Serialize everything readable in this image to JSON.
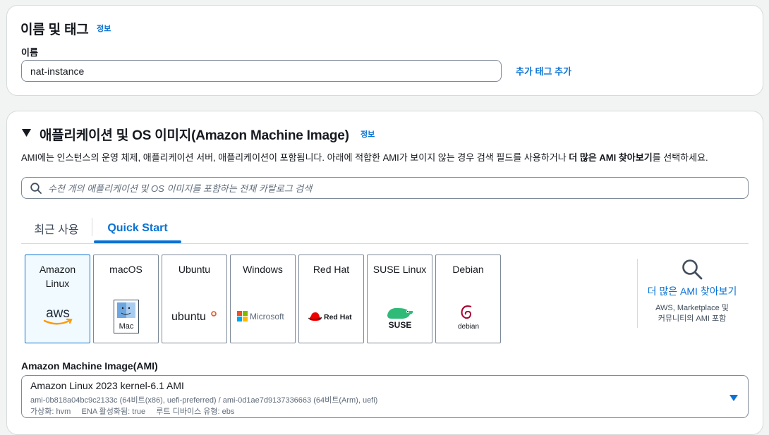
{
  "name_tags": {
    "title": "이름 및 태그",
    "info": "정보",
    "name_label": "이름",
    "name_value": "nat-instance",
    "add_tags": "추가 태그 추가"
  },
  "ami": {
    "title": "애플리케이션 및 OS 이미지(Amazon Machine Image)",
    "info": "정보",
    "description_pre": "AMI에는 인스턴스의 운영 체제, 애플리케이션 서버, 애플리케이션이 포함됩니다. 아래에 적합한 AMI가 보이지 않는 경우 검색 필드를 사용하거나 ",
    "description_bold": "더 많은 AMI 찾아보기",
    "description_post": "를 선택하세요.",
    "search_placeholder": "수천 개의 애플리케이션 및 OS 이미지를 포함하는 전체 카탈로그 검색",
    "tabs": [
      {
        "label": "최근 사용",
        "active": false
      },
      {
        "label": "Quick Start",
        "active": true
      }
    ],
    "os_options": [
      {
        "name": "Amazon Linux",
        "logo": "aws-logo",
        "selected": true
      },
      {
        "name": "macOS",
        "logo": "mac-logo",
        "logo_text": "Mac",
        "selected": false
      },
      {
        "name": "Ubuntu",
        "logo": "ubuntu-logo",
        "logo_text": "ubuntu",
        "selected": false
      },
      {
        "name": "Windows",
        "logo": "microsoft-logo",
        "logo_text": "Microsoft",
        "selected": false
      },
      {
        "name": "Red Hat",
        "logo": "redhat-logo",
        "logo_text": "Red Hat",
        "selected": false
      },
      {
        "name": "SUSE Linux",
        "logo": "suse-logo",
        "logo_text": "SUSE",
        "selected": false
      },
      {
        "name": "Debian",
        "logo": "debian-logo",
        "logo_text": "debian",
        "selected": false
      }
    ],
    "browse_more": {
      "link": "더 많은 AMI 찾아보기",
      "sub_line1": "AWS, Marketplace 및",
      "sub_line2": "커뮤니티의 AMI 포함"
    },
    "ami_label": "Amazon Machine Image(AMI)",
    "selected_ami": {
      "name": "Amazon Linux 2023 kernel-6.1 AMI",
      "ids": "ami-0b818a04bc9c2133c (64비트(x86), uefi-preferred) / ami-0d1ae7d9137336663 (64비트(Arm), uefi)",
      "details": "가상화: hvm     ENA 활성화됨: true     루트 디바이스 유형: ebs"
    }
  },
  "colors": {
    "link": "#0972d3",
    "border": "#7d8998",
    "selected_bg": "#f1faff",
    "aws_orange": "#ff9900",
    "ubuntu_orange": "#e95420",
    "redhat_red": "#ee0000",
    "suse_green": "#30ba78",
    "debian_red": "#a80030"
  }
}
